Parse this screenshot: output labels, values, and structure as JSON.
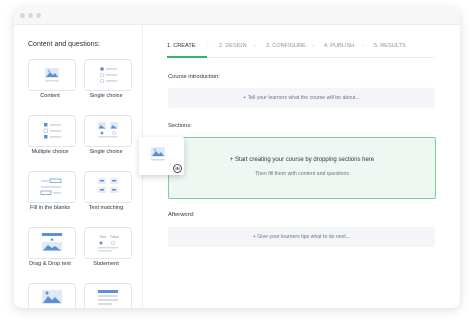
{
  "sidebar": {
    "title": "Content and questions:",
    "tiles": [
      {
        "label": "Content",
        "icon": "image-content-icon"
      },
      {
        "label": "Single choice",
        "icon": "single-choice-icon"
      },
      {
        "label": "Multiple choice",
        "icon": "multiple-choice-icon"
      },
      {
        "label": "Single choice",
        "icon": "image-single-choice-icon"
      },
      {
        "label": "Fill in the blanks",
        "icon": "fill-blanks-icon"
      },
      {
        "label": "Text matching",
        "icon": "text-matching-icon"
      },
      {
        "label": "Drag & Drop text",
        "icon": "drag-drop-icon"
      },
      {
        "label": "Statement",
        "icon": "statement-icon",
        "true_text": "True",
        "false_text": "False"
      },
      {
        "label": "",
        "icon": "image-question-icon"
      },
      {
        "label": "",
        "icon": "list-question-icon"
      }
    ]
  },
  "steps": [
    {
      "label": "1. CREATE",
      "active": true
    },
    {
      "label": "2. DESIGN",
      "active": false
    },
    {
      "label": "3. CONFIGURE",
      "active": false
    },
    {
      "label": "4. PUBLISH",
      "active": false
    },
    {
      "label": "5. RESULTS",
      "active": false
    }
  ],
  "main": {
    "intro_label": "Course introduction:",
    "intro_placeholder": "+ Tell your learners what the course will be about...",
    "sections_label": "Sections:",
    "sections_primary": "+ Start creating your course by dropping sections here",
    "sections_secondary": "Then fill them with content and questions",
    "afterword_label": "Afterword:",
    "afterword_placeholder": "+ Give your learners tips what to do next..."
  },
  "colors": {
    "accent": "#35b36b",
    "icon_blue": "#5b8fd6",
    "drop_bg": "#f3f5f8",
    "drop_green_bg": "#eef7f1",
    "drop_green_border": "#7fcf98"
  }
}
